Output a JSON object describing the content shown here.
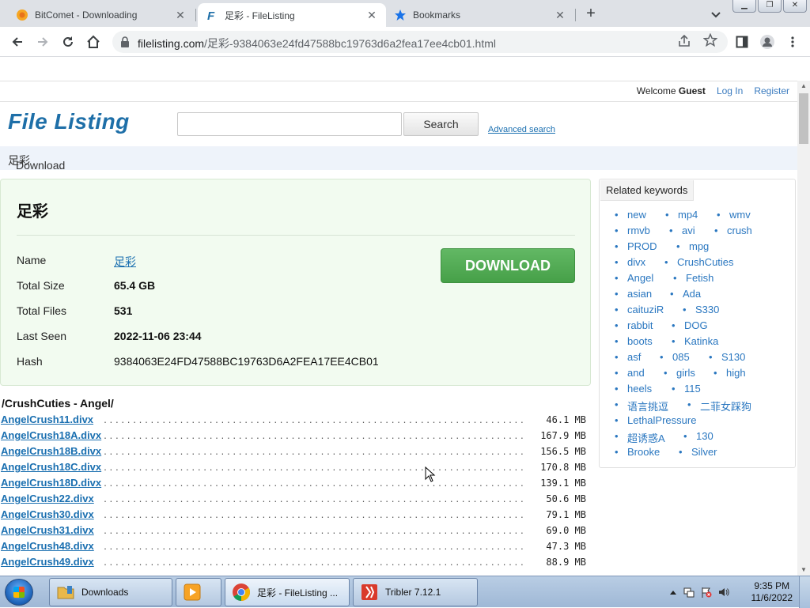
{
  "browser": {
    "tabs": [
      {
        "label": "BitComet - Downloading",
        "icon": "bitcomet-icon",
        "active": false
      },
      {
        "label": "足彩 - FileListing",
        "icon": "filelisting-icon",
        "active": true
      },
      {
        "label": "Bookmarks",
        "icon": "star-icon",
        "active": false
      }
    ],
    "url_host": "filelisting.com",
    "url_path": "/足彩-9384063e24fd47588bc19763d6a2fea17ee4cb01.html"
  },
  "site": {
    "logo": "File Listing",
    "welcome_prefix": "Welcome",
    "user": "Guest",
    "login": "Log In",
    "register": "Register",
    "search_button": "Search",
    "search_value": "",
    "advanced_search": "Advanced search",
    "breadcrumb_prefix": "Download",
    "breadcrumb_item": "足彩"
  },
  "torrent": {
    "title": "足彩",
    "download_label": "DOWNLOAD",
    "fields": [
      {
        "key": "Name",
        "value": "足彩"
      },
      {
        "key": "Total Size",
        "value": "65.4 GB"
      },
      {
        "key": "Total Files",
        "value": "531"
      },
      {
        "key": "Last Seen",
        "value": "2022-11-06 23:44"
      },
      {
        "key": "Hash",
        "value": "9384063E24FD47588BC19763D6A2FEA17EE4CB01"
      }
    ]
  },
  "related": {
    "heading": "Related keywords",
    "keywords": [
      "new",
      "mp4",
      "wmv",
      "rmvb",
      "avi",
      "crush",
      "PROD",
      "mpg",
      "divx",
      "CrushCuties",
      "Angel",
      "Fetish",
      "asian",
      "Ada",
      "caituziR",
      "S330",
      "rabbit",
      "DOG",
      "boots",
      "Katinka",
      "asf",
      "085",
      "S130",
      "and",
      "girls",
      "high",
      "heels",
      "115",
      "语言挑逗",
      "二菲女踩狗",
      "LethalPressure",
      "超诱惑A",
      "130",
      "Brooke",
      "Silver"
    ]
  },
  "files": {
    "directory": "/CrushCuties - Angel/",
    "items": [
      {
        "name": "AngelCrush11.divx",
        "size": "46.1 MB"
      },
      {
        "name": "AngelCrush18A.divx",
        "size": "167.9 MB"
      },
      {
        "name": "AngelCrush18B.divx",
        "size": "156.5 MB"
      },
      {
        "name": "AngelCrush18C.divx",
        "size": "170.8 MB"
      },
      {
        "name": "AngelCrush18D.divx",
        "size": "139.1 MB"
      },
      {
        "name": "AngelCrush22.divx",
        "size": "50.6 MB"
      },
      {
        "name": "AngelCrush30.divx",
        "size": "79.1 MB"
      },
      {
        "name": "AngelCrush31.divx",
        "size": "69.0 MB"
      },
      {
        "name": "AngelCrush48.divx",
        "size": "47.3 MB"
      },
      {
        "name": "AngelCrush49.divx",
        "size": "88.9 MB"
      }
    ]
  },
  "taskbar": {
    "items": [
      {
        "label": "Downloads",
        "icon": "folder-icon"
      },
      {
        "label": "",
        "icon": "media-player-icon"
      },
      {
        "label": "足彩 - FileListing ...",
        "icon": "chrome-icon"
      },
      {
        "label": "Tribler 7.12.1",
        "icon": "tribler-icon"
      }
    ],
    "time": "9:35 PM",
    "date": "11/6/2022"
  },
  "colors": {
    "accent_link": "#1a6fb0",
    "download_green": "#4caf50",
    "logo_blue": "#1e6fa8"
  }
}
